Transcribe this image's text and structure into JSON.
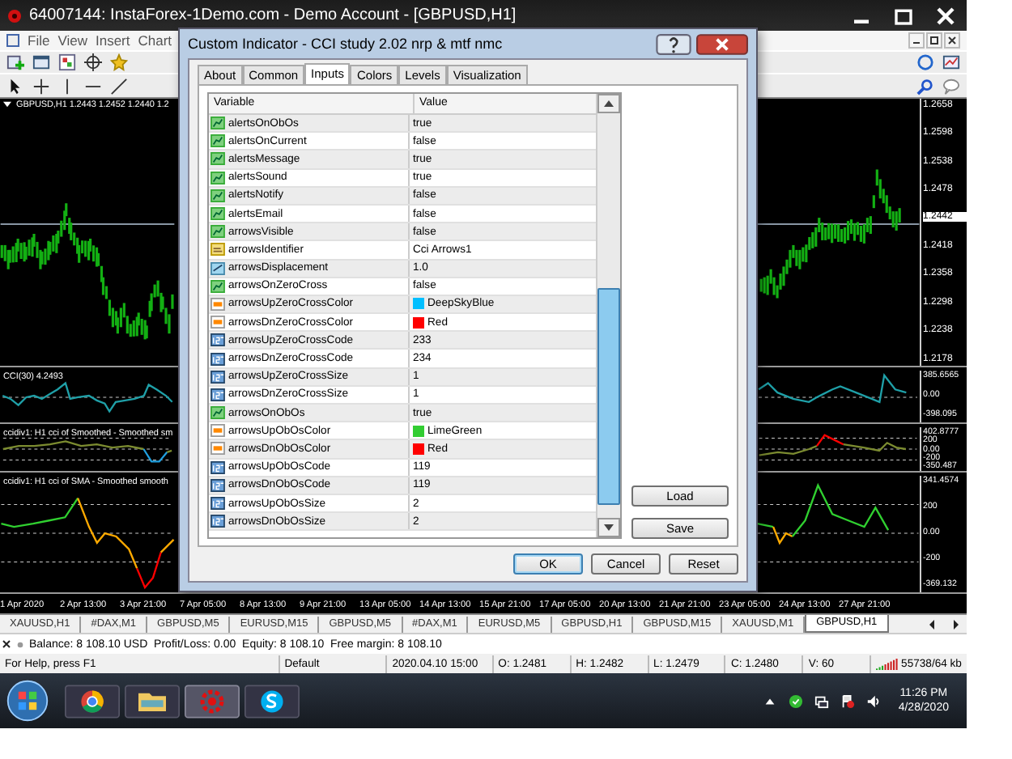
{
  "window": {
    "title": "64007144: InstaForex-1Demo.com - Demo Account - [GBPUSD,H1]"
  },
  "menu": [
    "File",
    "View",
    "Insert",
    "Chart"
  ],
  "chart": {
    "header": "GBPUSD,H1  1.2443 1.2452 1.2440 1.2",
    "price_labels": [
      {
        "text": "1.2658",
        "current": false
      },
      {
        "text": "1.2598",
        "current": false
      },
      {
        "text": "1.2538",
        "current": false
      },
      {
        "text": "1.2478",
        "current": false
      },
      {
        "text": "1.2442",
        "current": true
      },
      {
        "text": "1.2418",
        "current": false
      },
      {
        "text": "1.2358",
        "current": false
      },
      {
        "text": "1.2298",
        "current": false
      },
      {
        "text": "1.2238",
        "current": false
      },
      {
        "text": "1.2178",
        "current": false
      }
    ],
    "panes": [
      {
        "title": "CCI(30) 4.2493",
        "scale": [
          "385.6565",
          "0.00",
          "-398.095"
        ]
      },
      {
        "title": "ccidiv1: H1 cci of Smoothed - Smoothed sm",
        "scale": [
          "402.8777",
          "200",
          "0.00",
          "-200",
          "-350.487"
        ]
      },
      {
        "title": "ccidiv1: H1 cci of SMA - Smoothed smooth",
        "scale": [
          "341.4574",
          "200",
          "0.00",
          "-200",
          "-369.132"
        ]
      }
    ],
    "time_labels": [
      "1 Apr 2020",
      "2 Apr 13:00",
      "3 Apr 21:00",
      "7 Apr 05:00",
      "8 Apr 13:00",
      "9 Apr 21:00",
      "13 Apr 05:00",
      "14 Apr 13:00",
      "15 Apr 21:00",
      "17 Apr 05:00",
      "20 Apr 13:00",
      "21 Apr 21:00",
      "23 Apr 05:00",
      "24 Apr 13:00",
      "27 Apr 21:00"
    ]
  },
  "dialog": {
    "title": "Custom Indicator - CCI study 2.02 nrp & mtf nmc",
    "tabs": [
      {
        "label": "About",
        "selected": false
      },
      {
        "label": "Common",
        "selected": false
      },
      {
        "label": "Inputs",
        "selected": true
      },
      {
        "label": "Colors",
        "selected": false
      },
      {
        "label": "Levels",
        "selected": false
      },
      {
        "label": "Visualization",
        "selected": false
      }
    ],
    "columns": [
      "Variable",
      "Value"
    ],
    "rows": [
      {
        "variable": "alertsOnObOs",
        "value": "true",
        "kind": "bool"
      },
      {
        "variable": "alertsOnCurrent",
        "value": "false",
        "kind": "bool"
      },
      {
        "variable": "alertsMessage",
        "value": "true",
        "kind": "bool"
      },
      {
        "variable": "alertsSound",
        "value": "true",
        "kind": "bool"
      },
      {
        "variable": "alertsNotify",
        "value": "false",
        "kind": "bool"
      },
      {
        "variable": "alertsEmail",
        "value": "false",
        "kind": "bool"
      },
      {
        "variable": "arrowsVisible",
        "value": "false",
        "kind": "bool"
      },
      {
        "variable": "arrowsIdentifier",
        "value": "Cci Arrows1",
        "kind": "string"
      },
      {
        "variable": "arrowsDisplacement",
        "value": "1.0",
        "kind": "double"
      },
      {
        "variable": "arrowsOnZeroCross",
        "value": "false",
        "kind": "bool"
      },
      {
        "variable": "arrowsUpZeroCrossColor",
        "value": "DeepSkyBlue",
        "kind": "color",
        "color": "#00bfff"
      },
      {
        "variable": "arrowsDnZeroCrossColor",
        "value": "Red",
        "kind": "color",
        "color": "#ff0000"
      },
      {
        "variable": "arrowsUpZeroCrossCode",
        "value": "233",
        "kind": "int"
      },
      {
        "variable": "arrowsDnZeroCrossCode",
        "value": "234",
        "kind": "int"
      },
      {
        "variable": "arrowsUpZeroCrossSize",
        "value": "1",
        "kind": "int"
      },
      {
        "variable": "arrowsDnZeroCrossSize",
        "value": "1",
        "kind": "int"
      },
      {
        "variable": "arrowsOnObOs",
        "value": "true",
        "kind": "bool"
      },
      {
        "variable": "arrowsUpObOsColor",
        "value": "LimeGreen",
        "kind": "color",
        "color": "#32cd32"
      },
      {
        "variable": "arrowsDnObOsColor",
        "value": "Red",
        "kind": "color",
        "color": "#ff0000"
      },
      {
        "variable": "arrowsUpObOsCode",
        "value": "119",
        "kind": "int"
      },
      {
        "variable": "arrowsDnObOsCode",
        "value": "119",
        "kind": "int"
      },
      {
        "variable": "arrowsUpObOsSize",
        "value": "2",
        "kind": "int"
      },
      {
        "variable": "arrowsDnObOsSize",
        "value": "2",
        "kind": "int"
      }
    ],
    "side_buttons": [
      "Load",
      "Save"
    ],
    "buttons": [
      "OK",
      "Cancel",
      "Reset"
    ]
  },
  "chart_tabs": [
    {
      "label": "XAUUSD,H1",
      "selected": false
    },
    {
      "label": "#DAX,M1",
      "selected": false
    },
    {
      "label": "GBPUSD,M5",
      "selected": false
    },
    {
      "label": "EURUSD,M15",
      "selected": false
    },
    {
      "label": "GBPUSD,M5",
      "selected": false
    },
    {
      "label": "#DAX,M1",
      "selected": false
    },
    {
      "label": "EURUSD,M5",
      "selected": false
    },
    {
      "label": "GBPUSD,H1",
      "selected": false
    },
    {
      "label": "GBPUSD,M15",
      "selected": false
    },
    {
      "label": "XAUUSD,M1",
      "selected": false
    },
    {
      "label": "GBPUSD,H1",
      "selected": true
    }
  ],
  "terminal": "Balance: 8 108.10 USD  Profit/Loss: 0.00  Equity: 8 108.10  Free margin: 8 108.10",
  "status_bar": [
    "For Help, press F1",
    "Default",
    "2020.04.10 15:00",
    "O: 1.2481",
    "H: 1.2482",
    "L: 1.2479",
    "C: 1.2480",
    "V: 60",
    "55738/64 kb"
  ],
  "clock": {
    "time": "11:26 PM",
    "date": "4/28/2020"
  }
}
